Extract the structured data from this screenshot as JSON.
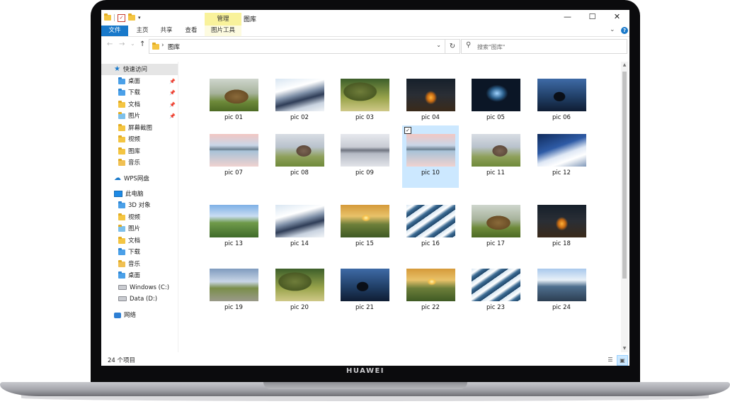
{
  "window": {
    "title": "图库",
    "context_tab_header": "管理",
    "buttons": {
      "minimize": "—",
      "maximize": "☐",
      "close": "✕"
    }
  },
  "ribbon": {
    "tabs": [
      "文件",
      "主页",
      "共享",
      "查看",
      "图片工具"
    ],
    "collapse_icon": "chevron-down-icon",
    "help_label": "?"
  },
  "address": {
    "back": "←",
    "forward": "→",
    "recent": "⌄",
    "up": "↑",
    "crumb_separator": "›",
    "path": "图库",
    "refresh": "↻"
  },
  "search": {
    "placeholder": "搜索\"图库\""
  },
  "sidebar": {
    "quick_access": "快速访问",
    "quick_items": [
      {
        "label": "桌面",
        "pinned": true,
        "icon": "desktop-folder-icon"
      },
      {
        "label": "下载",
        "pinned": true,
        "icon": "download-folder-icon"
      },
      {
        "label": "文档",
        "pinned": true,
        "icon": "documents-folder-icon"
      },
      {
        "label": "图片",
        "pinned": true,
        "icon": "pictures-folder-icon"
      },
      {
        "label": "屏幕截图",
        "pinned": false,
        "icon": "folder-icon"
      },
      {
        "label": "视频",
        "pinned": false,
        "icon": "videos-folder-icon"
      },
      {
        "label": "图库",
        "pinned": false,
        "icon": "folder-icon"
      },
      {
        "label": "音乐",
        "pinned": false,
        "icon": "music-folder-icon"
      }
    ],
    "wps": "WPS网盘",
    "this_pc": "此电脑",
    "pc_items": [
      {
        "label": "3D 对象",
        "icon": "3d-objects-folder-icon"
      },
      {
        "label": "视频",
        "icon": "videos-folder-icon"
      },
      {
        "label": "图片",
        "icon": "pictures-folder-icon"
      },
      {
        "label": "文档",
        "icon": "documents-folder-icon"
      },
      {
        "label": "下载",
        "icon": "download-folder-icon"
      },
      {
        "label": "音乐",
        "icon": "music-folder-icon"
      },
      {
        "label": "桌面",
        "icon": "desktop-folder-icon"
      },
      {
        "label": "Windows (C:)",
        "icon": "drive-icon"
      },
      {
        "label": "Data (D:)",
        "icon": "drive-icon"
      }
    ],
    "network": "网络",
    "pin_glyph": "📌"
  },
  "files": [
    {
      "name": "pic 01",
      "scene": "frog"
    },
    {
      "name": "pic 02",
      "scene": "clouds"
    },
    {
      "name": "pic 03",
      "scene": "tree"
    },
    {
      "name": "pic 04",
      "scene": "night-rock"
    },
    {
      "name": "pic 05",
      "scene": "cave"
    },
    {
      "name": "pic 06",
      "scene": "milkyway"
    },
    {
      "name": "pic 07",
      "scene": "lake"
    },
    {
      "name": "pic 08",
      "scene": "elephant"
    },
    {
      "name": "pic 09",
      "scene": "castle"
    },
    {
      "name": "pic 10",
      "scene": "lake",
      "selected": true
    },
    {
      "name": "pic 11",
      "scene": "elephant"
    },
    {
      "name": "pic 12",
      "scene": "snowmtn"
    },
    {
      "name": "pic 13",
      "scene": "valley"
    },
    {
      "name": "pic 14",
      "scene": "clouds"
    },
    {
      "name": "pic 15",
      "scene": "sunset"
    },
    {
      "name": "pic 16",
      "scene": "waves"
    },
    {
      "name": "pic 17",
      "scene": "frog"
    },
    {
      "name": "pic 18",
      "scene": "night-rock"
    },
    {
      "name": "pic 19",
      "scene": "road"
    },
    {
      "name": "pic 20",
      "scene": "tree"
    },
    {
      "name": "pic 21",
      "scene": "milkyway"
    },
    {
      "name": "pic 22",
      "scene": "sunset"
    },
    {
      "name": "pic 23",
      "scene": "waves"
    },
    {
      "name": "pic 24",
      "scene": "coast"
    }
  ],
  "status": {
    "item_count": "24 个项目"
  },
  "device": {
    "brand": "HUAWEI"
  },
  "colors": {
    "accent": "#1979ca",
    "selection": "#cce8ff",
    "context_tab": "#f9f29b"
  }
}
